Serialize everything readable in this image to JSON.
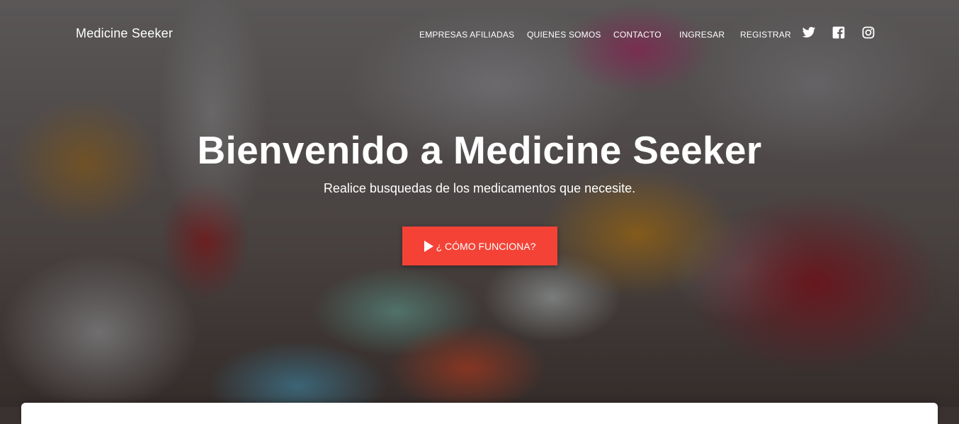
{
  "brand": "Medicine Seeker",
  "nav": {
    "links": [
      "EMPRESAS AFILIADAS",
      "QUIENES SOMOS",
      "CONTACTO",
      "INGRESAR",
      "REGISTRAR"
    ],
    "social": [
      "twitter-icon",
      "facebook-icon",
      "instagram-icon"
    ]
  },
  "hero": {
    "title": "Bienvenido a Medicine Seeker",
    "subtitle": "Realice busquedas de los medicamentos que necesite.",
    "cta_label": "¿ CÓMO FUNCIONA?",
    "cta_icon": "play-icon"
  },
  "colors": {
    "accent": "#f44336",
    "text": "#ffffff"
  }
}
